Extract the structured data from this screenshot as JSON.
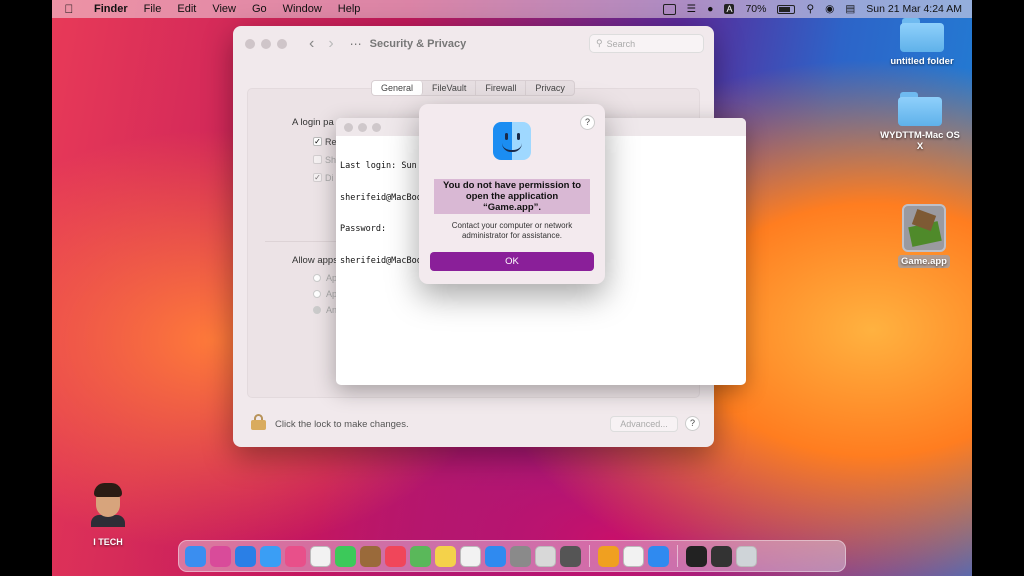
{
  "menubar": {
    "apple": "",
    "app": "Finder",
    "menus": [
      "File",
      "Edit",
      "View",
      "Go",
      "Window",
      "Help"
    ],
    "battery": "70%",
    "datetime": "Sun 21 Mar  4:24 AM"
  },
  "desktop": {
    "icons": [
      "untitled folder",
      "WYDTTM-Mac OS X",
      "Game.app"
    ]
  },
  "prefs": {
    "title": "Security & Privacy",
    "search_placeholder": "Search",
    "tabs": [
      "General",
      "FileVault",
      "Firewall",
      "Privacy"
    ],
    "login_label": "A login pa",
    "checkbox_labels": [
      "Re",
      "Sh",
      "Di"
    ],
    "allow_label": "Allow apps",
    "radio_labels": [
      "Ap",
      "Ap",
      "An"
    ],
    "lock_text": "Click the lock to make changes.",
    "advanced_label": "Advanced...",
    "help": "?"
  },
  "terminal": {
    "lines": [
      "Last login: Sun",
      "sherifeid@MacBoo",
      "Password:",
      "sherifeid@MacBoo"
    ]
  },
  "alert": {
    "help": "?",
    "title_line1": "You do not have permission to",
    "title_line2": "open the application",
    "title_line3": "“Game.app”.",
    "message_line1": "Contact your computer or network",
    "message_line2": "administrator for assistance.",
    "ok_label": "OK"
  },
  "avatar": {
    "name": "I TECH"
  },
  "dock": {
    "colors": [
      "#3a8ef0",
      "#d94b9a",
      "#2a7fe6",
      "#3a9ef5",
      "#e8508a",
      "#f2f2f2",
      "#3cc95a",
      "#9a6a3a",
      "#f0465a",
      "#5ab85a",
      "#f4d24a",
      "#f2f2f2",
      "#2f8af0",
      "#8a8a8a",
      "#d8d8d8",
      "#555",
      "#f0a020",
      "#f2f2f2",
      "#2f8af0",
      "#222",
      "#333",
      "#cfd4d8"
    ]
  }
}
